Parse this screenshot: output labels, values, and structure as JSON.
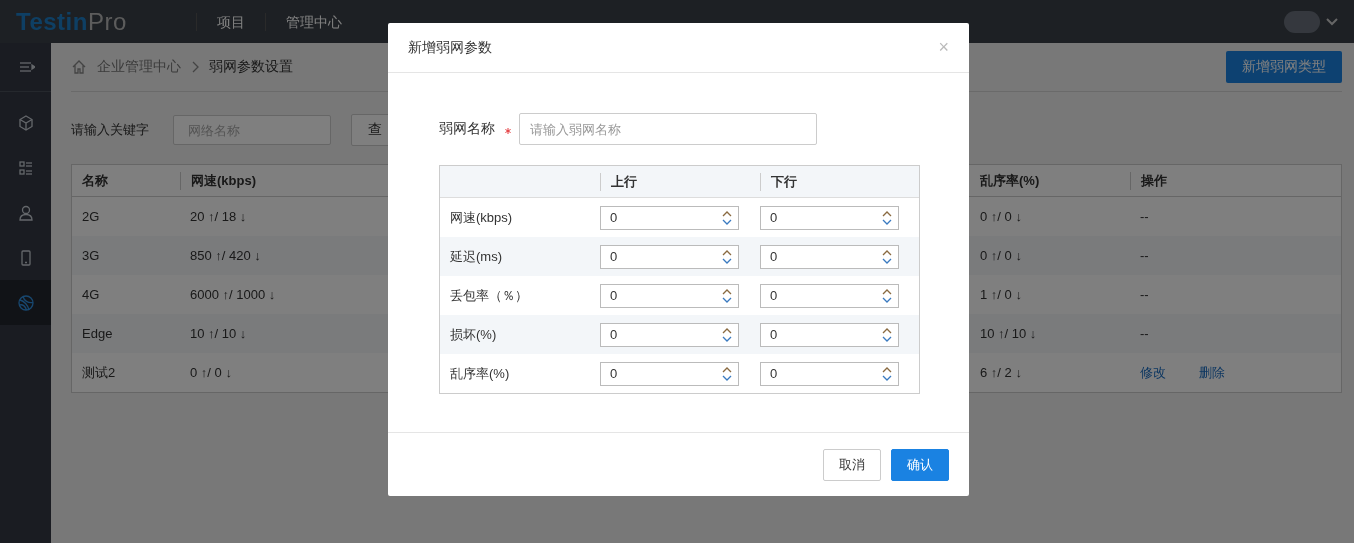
{
  "header": {
    "logo": {
      "brand": "Testin",
      "suffix": "Pro"
    },
    "nav": [
      "项目",
      "管理中心"
    ]
  },
  "sidebar": [
    {
      "kind": "toggle",
      "selected": false
    },
    {
      "kind": "cube",
      "selected": false
    },
    {
      "kind": "list",
      "selected": false
    },
    {
      "kind": "user",
      "selected": false
    },
    {
      "kind": "phone",
      "selected": false
    },
    {
      "kind": "globe",
      "selected": true
    }
  ],
  "breadcrumb": [
    "企业管理中心",
    "弱网参数设置"
  ],
  "add_button": "新增弱网类型",
  "filter": {
    "label": "请输入关键字",
    "placeholder": "网络名称",
    "button": "查"
  },
  "table": {
    "columns": [
      "名称",
      "网速(kbps)",
      "乱序率(%)",
      "操作"
    ],
    "rows": [
      {
        "cells": [
          "2G",
          "20 ↑/ 18 ↓",
          "0 ↑/ 0 ↓"
        ],
        "operation": "--"
      },
      {
        "cells": [
          "3G",
          "850 ↑/ 420 ↓",
          "0 ↑/ 0 ↓"
        ],
        "operation": "--"
      },
      {
        "cells": [
          "4G",
          "6000 ↑/ 1000 ↓",
          "1 ↑/ 0 ↓"
        ],
        "operation": "--"
      },
      {
        "cells": [
          "Edge",
          "10 ↑/ 10 ↓",
          "10 ↑/ 10 ↓"
        ],
        "operation": "--"
      },
      {
        "cells": [
          "测试2",
          "0 ↑/ 0 ↓",
          "6 ↑/ 2 ↓"
        ],
        "links": [
          "修改",
          "删除"
        ]
      }
    ]
  },
  "dialog": {
    "title": "新增弱网参数",
    "close": "×",
    "name_field": {
      "label": "弱网名称",
      "required": true,
      "placeholder": "请输入弱网名称"
    },
    "param_table": {
      "columns": [
        "上行",
        "下行"
      ],
      "rows": [
        {
          "label": "网速(kbps)",
          "up": "0",
          "down": "0"
        },
        {
          "label": "延迟(ms)",
          "up": "0",
          "down": "0"
        },
        {
          "label": "丢包率（％）",
          "up": "0",
          "down": "0"
        },
        {
          "label": "损坏(%)",
          "up": "0",
          "down": "0"
        },
        {
          "label": "乱序率(%)",
          "up": "0",
          "down": "0"
        }
      ]
    },
    "buttons": [
      {
        "label": "取消",
        "kind": "secondary"
      },
      {
        "label": "确认",
        "kind": "primary"
      }
    ]
  }
}
